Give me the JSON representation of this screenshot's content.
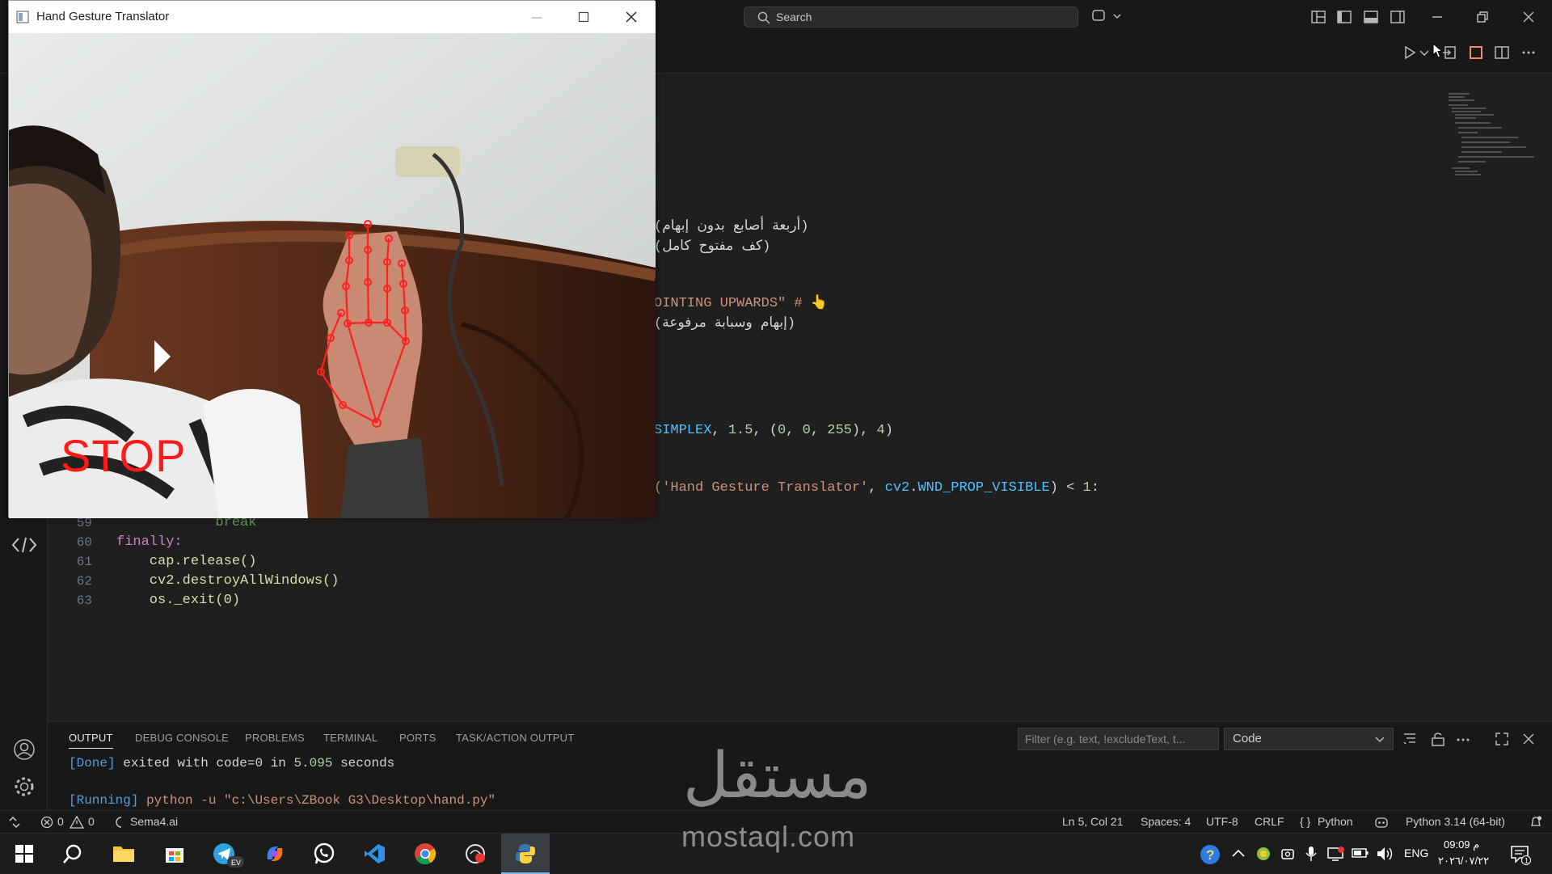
{
  "titlebar": {
    "search_placeholder": "Search"
  },
  "camera_window": {
    "title": "Hand Gesture Translator",
    "gesture_label": "STOP"
  },
  "editor": {
    "fragments": {
      "arabic_1": "(أربعة أصابع بدون إبهام",
      "arabic_2": "(كف مفتوح كامل",
      "pointing_line": "OINTING UPWARDS\" # 👆",
      "arabic_3": "(إبهام وسبابة مرفوعة",
      "puttext_line": {
        "a": "SIMPLEX",
        "b": ", ",
        "c": "1.5",
        "d": ", (",
        "e": "0",
        "f": ", ",
        "g": "0",
        "h": ", ",
        "i": "255",
        "j": "), ",
        "k": "4",
        "l": ")"
      },
      "wnd_line": {
        "a": "('Hand Gesture Translator'",
        "b": ", ",
        "c": "cv2",
        "d": ".",
        "e": "WND_PROP_VISIBLE",
        "f": ") < ",
        "g": "1",
        "h": ":"
      }
    },
    "lines": [
      {
        "num": "59",
        "code": "            break"
      },
      {
        "num": "60",
        "code": "finally:"
      },
      {
        "num": "61",
        "code": "    cap.release()"
      },
      {
        "num": "62",
        "code": "    cv2.destroyAllWindows()"
      },
      {
        "num": "63",
        "code": "    os._exit(0)"
      }
    ]
  },
  "panel": {
    "tabs": [
      "OUTPUT",
      "DEBUG CONSOLE",
      "PROBLEMS",
      "TERMINAL",
      "PORTS",
      "TASK/ACTION OUTPUT"
    ],
    "active_tab": "OUTPUT",
    "filter_placeholder": "Filter (e.g. text, !excludeText, t...",
    "output_channel": "Code",
    "output": {
      "done_tag": "[Done]",
      "done_msg": " exited with code=0 in ",
      "done_time": "5.095",
      "done_unit": " seconds",
      "running_tag": "[Running]",
      "running_cmd": " python -u \"c:\\Users\\ZBook G3\\Desktop\\hand.py\""
    }
  },
  "statusbar": {
    "errors": "0",
    "warnings": "0",
    "remote": "Sema4.ai",
    "position": "Ln 5, Col 21",
    "spaces": "Spaces: 4",
    "encoding": "UTF-8",
    "eol": "CRLF",
    "language": "Python",
    "interpreter": "Python 3.14 (64-bit)"
  },
  "taskbar": {
    "lang": "ENG",
    "time": "09:09 م",
    "date": "٢٠٢٦/٠٧/٢٢",
    "telegram_badge": "EV"
  },
  "watermark": {
    "arabic": "مستقل",
    "latin": "mostaql.com"
  },
  "colors": {
    "accent": "#76b9ed",
    "stop_red": "#ff1a1a",
    "landmark_red": "#ff2020"
  }
}
